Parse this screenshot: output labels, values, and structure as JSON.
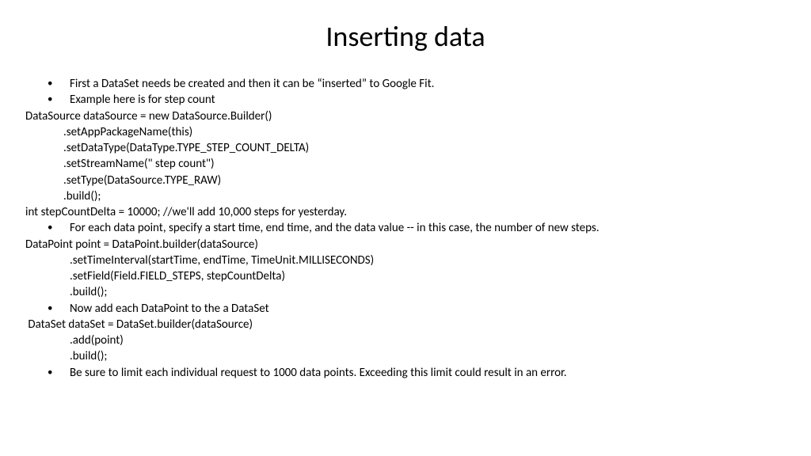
{
  "title": "Inserting data",
  "bullets": {
    "b1": "First a DataSet needs be created and then it can be “inserted” to Google Fit.",
    "b2": "Example here is for step count",
    "b3": "For each data point, specify a start time, end time, and the data value -- in this case, the number of new steps.",
    "b4": "Now add each DataPoint to the a DataSet",
    "b5": "Be sure to limit each individual request to 1000 data points. Exceeding this limit could result in an error."
  },
  "code": {
    "c1": "DataSource dataSource = new DataSource.Builder()",
    "c2": ".setAppPackageName(this)",
    "c3": ".setDataType(DataType.TYPE_STEP_COUNT_DELTA)",
    "c4": ".setStreamName(\" step count\")",
    "c5": ".setType(DataSource.TYPE_RAW)",
    "c6": ".build();",
    "c7": "int stepCountDelta = 10000; //we'll add 10,000 steps for yesterday.",
    "c8": "DataPoint point = DataPoint.builder(dataSource)",
    "c9": ".setTimeInterval(startTime, endTime, TimeUnit.MILLISECONDS)",
    "c10": ".setField(Field.FIELD_STEPS, stepCountDelta)",
    "c11": ".build();",
    "c12": " DataSet dataSet = DataSet.builder(dataSource)",
    "c13": ".add(point)",
    "c14": ".build();"
  }
}
